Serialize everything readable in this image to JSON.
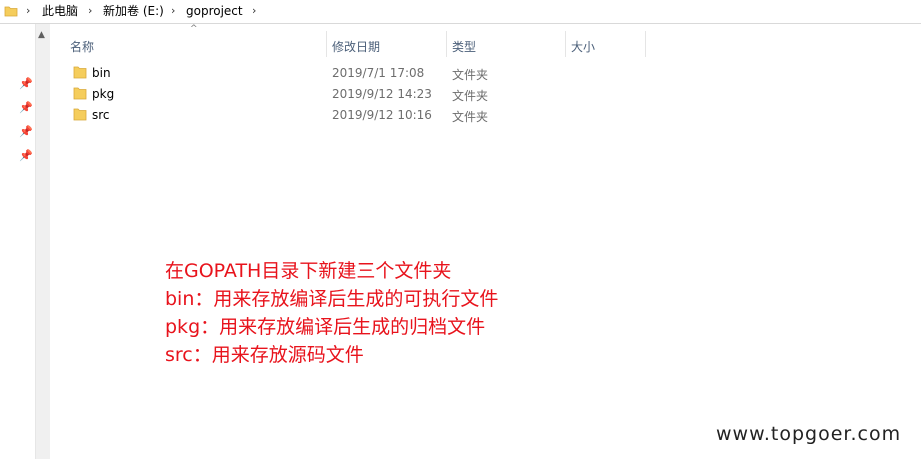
{
  "breadcrumb": {
    "items": [
      "此电脑",
      "新加卷 (E:)",
      "goproject"
    ]
  },
  "columns": {
    "name": "名称",
    "date": "修改日期",
    "type": "类型",
    "size": "大小"
  },
  "files": [
    {
      "name": "bin",
      "date": "2019/7/1 17:08",
      "type": "文件夹"
    },
    {
      "name": "pkg",
      "date": "2019/9/12 14:23",
      "type": "文件夹"
    },
    {
      "name": "src",
      "date": "2019/9/12 10:16",
      "type": "文件夹"
    }
  ],
  "annotation": {
    "lines": [
      "在GOPATH目录下新建三个文件夹",
      "bin：用来存放编译后生成的可执行文件",
      "pkg：用来存放编译后生成的归档文件",
      "src：用来存放源码文件"
    ]
  },
  "watermark": "www.topgoer.com",
  "colors": {
    "annotation": "#e8131c",
    "folder": "#f5cd5c",
    "header_text": "#4c607a"
  },
  "icons": {
    "folder": "folder-icon",
    "pin": "pin-icon",
    "chevron": "chevron-right-icon",
    "scroll_up": "scroll-up-arrow-icon",
    "sort": "sort-ascending-icon"
  }
}
